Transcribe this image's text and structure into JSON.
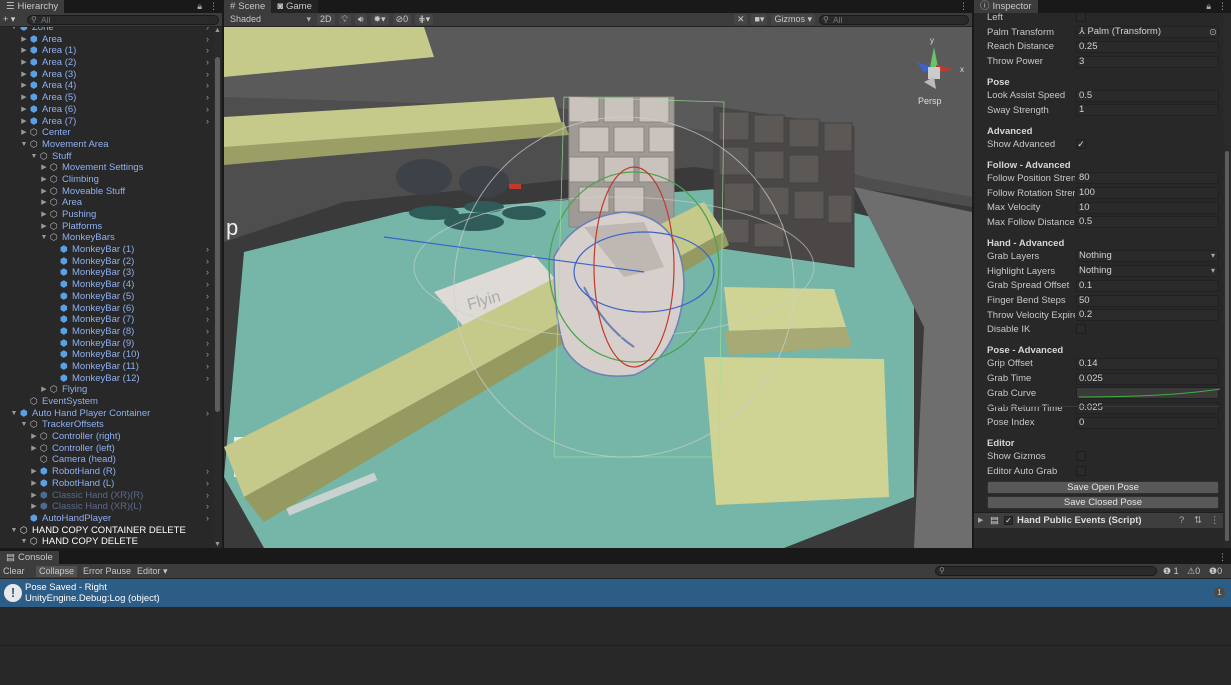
{
  "hierarchy": {
    "tab": "Hierarchy",
    "search_placeholder": "All",
    "add_label": "+ ▾",
    "items": [
      {
        "label": "Zone",
        "depth": 1,
        "arrow": "down",
        "icon": "cube",
        "more": true
      },
      {
        "label": "Area",
        "depth": 2,
        "arrow": "right",
        "icon": "cube",
        "more": true
      },
      {
        "label": "Area (1)",
        "depth": 2,
        "arrow": "right",
        "icon": "cube",
        "more": true
      },
      {
        "label": "Area (2)",
        "depth": 2,
        "arrow": "right",
        "icon": "cube",
        "more": true
      },
      {
        "label": "Area (3)",
        "depth": 2,
        "arrow": "right",
        "icon": "cube",
        "more": true
      },
      {
        "label": "Area (4)",
        "depth": 2,
        "arrow": "right",
        "icon": "cube",
        "more": true
      },
      {
        "label": "Area (5)",
        "depth": 2,
        "arrow": "right",
        "icon": "cube",
        "more": true
      },
      {
        "label": "Area (6)",
        "depth": 2,
        "arrow": "right",
        "icon": "cube",
        "more": true
      },
      {
        "label": "Area (7)",
        "depth": 2,
        "arrow": "right",
        "icon": "cube",
        "more": true
      },
      {
        "label": "Center",
        "depth": 2,
        "arrow": "right",
        "icon": "outline",
        "more": false
      },
      {
        "label": "Movement Area",
        "depth": 2,
        "arrow": "down",
        "icon": "outline",
        "more": false
      },
      {
        "label": "Stuff",
        "depth": 3,
        "arrow": "down",
        "icon": "outline",
        "more": false
      },
      {
        "label": "Movement Settings",
        "depth": 4,
        "arrow": "right",
        "icon": "outline",
        "more": false
      },
      {
        "label": "Climbing",
        "depth": 4,
        "arrow": "right",
        "icon": "outline",
        "more": false
      },
      {
        "label": "Moveable Stuff",
        "depth": 4,
        "arrow": "right",
        "icon": "outline",
        "more": false
      },
      {
        "label": "Area",
        "depth": 4,
        "arrow": "right",
        "icon": "outline",
        "more": false
      },
      {
        "label": "Pushing",
        "depth": 4,
        "arrow": "right",
        "icon": "outline",
        "more": false
      },
      {
        "label": "Platforms",
        "depth": 4,
        "arrow": "right",
        "icon": "outline",
        "more": false
      },
      {
        "label": "MonkeyBars",
        "depth": 4,
        "arrow": "down",
        "icon": "outline",
        "more": false
      },
      {
        "label": "MonkeyBar (1)",
        "depth": 5,
        "arrow": "",
        "icon": "cube",
        "more": true
      },
      {
        "label": "MonkeyBar (2)",
        "depth": 5,
        "arrow": "",
        "icon": "cube",
        "more": true
      },
      {
        "label": "MonkeyBar (3)",
        "depth": 5,
        "arrow": "",
        "icon": "cube",
        "more": true
      },
      {
        "label": "MonkeyBar (4)",
        "depth": 5,
        "arrow": "",
        "icon": "cube",
        "more": true
      },
      {
        "label": "MonkeyBar (5)",
        "depth": 5,
        "arrow": "",
        "icon": "cube",
        "more": true
      },
      {
        "label": "MonkeyBar (6)",
        "depth": 5,
        "arrow": "",
        "icon": "cube",
        "more": true
      },
      {
        "label": "MonkeyBar (7)",
        "depth": 5,
        "arrow": "",
        "icon": "cube",
        "more": true
      },
      {
        "label": "MonkeyBar (8)",
        "depth": 5,
        "arrow": "",
        "icon": "cube",
        "more": true
      },
      {
        "label": "MonkeyBar (9)",
        "depth": 5,
        "arrow": "",
        "icon": "cube",
        "more": true
      },
      {
        "label": "MonkeyBar (10)",
        "depth": 5,
        "arrow": "",
        "icon": "cube",
        "more": true
      },
      {
        "label": "MonkeyBar (11)",
        "depth": 5,
        "arrow": "",
        "icon": "cube",
        "more": true
      },
      {
        "label": "MonkeyBar (12)",
        "depth": 5,
        "arrow": "",
        "icon": "cube",
        "more": true
      },
      {
        "label": "Flying",
        "depth": 4,
        "arrow": "right",
        "icon": "outline",
        "more": false
      },
      {
        "label": "EventSystem",
        "depth": 2,
        "arrow": "",
        "icon": "outline",
        "more": false
      },
      {
        "label": "Auto Hand Player Container",
        "depth": 1,
        "arrow": "down",
        "icon": "cube",
        "more": true
      },
      {
        "label": "TrackerOffsets",
        "depth": 2,
        "arrow": "down",
        "icon": "outline",
        "more": false
      },
      {
        "label": "Controller (right)",
        "depth": 3,
        "arrow": "right",
        "icon": "outline",
        "more": false
      },
      {
        "label": "Controller (left)",
        "depth": 3,
        "arrow": "right",
        "icon": "outline",
        "more": false
      },
      {
        "label": "Camera (head)",
        "depth": 3,
        "arrow": "",
        "icon": "outline",
        "more": false
      },
      {
        "label": "RobotHand (R)",
        "depth": 3,
        "arrow": "right",
        "icon": "cube",
        "more": true
      },
      {
        "label": "RobotHand (L)",
        "depth": 3,
        "arrow": "right",
        "icon": "cube",
        "more": true
      },
      {
        "label": "Classic Hand (XR)(R)",
        "depth": 3,
        "arrow": "right",
        "icon": "cube",
        "more": true,
        "dim": true
      },
      {
        "label": "Classic Hand (XR)(L)",
        "depth": 3,
        "arrow": "right",
        "icon": "cube",
        "more": true,
        "dim": true
      },
      {
        "label": "AutoHandPlayer",
        "depth": 2,
        "arrow": "",
        "icon": "cube",
        "more": true
      },
      {
        "label": "HAND COPY CONTAINER DELETE",
        "depth": 1,
        "arrow": "down",
        "icon": "outline",
        "more": false,
        "white": true
      },
      {
        "label": "HAND COPY DELETE",
        "depth": 2,
        "arrow": "down",
        "icon": "outline",
        "more": false,
        "white": true
      }
    ]
  },
  "scene": {
    "tab_scene": "Scene",
    "tab_game": "Game",
    "shading_mode": "Shaded",
    "mode_2d": "2D",
    "gizmos_label": "Gizmos",
    "search_placeholder": "All",
    "fx_count": "0",
    "persp_label": "Persp",
    "axis_x": "x",
    "axis_y": "y",
    "sign_text_left": "p",
    "sign_text_center": "Flyin"
  },
  "inspector": {
    "tab": "Inspector",
    "rows": [
      {
        "type": "field",
        "label": "Left",
        "kind": "check",
        "value": ""
      },
      {
        "type": "field",
        "label": "Palm Transform",
        "kind": "object",
        "value": "⅄ Palm (Transform)"
      },
      {
        "type": "field",
        "label": "Reach Distance",
        "kind": "text",
        "value": "0.25"
      },
      {
        "type": "field",
        "label": "Throw Power",
        "kind": "text",
        "value": "3"
      },
      {
        "type": "header",
        "label": "Pose"
      },
      {
        "type": "field",
        "label": "Look Assist Speed",
        "kind": "text",
        "value": "0.5"
      },
      {
        "type": "field",
        "label": "Sway Strength",
        "kind": "text",
        "value": "1"
      },
      {
        "type": "header",
        "label": "Advanced"
      },
      {
        "type": "field",
        "label": "Show Advanced",
        "kind": "check",
        "value": "✓"
      },
      {
        "type": "header",
        "label": "Follow - Advanced"
      },
      {
        "type": "field",
        "label": "Follow Position Stren",
        "kind": "text",
        "value": "80"
      },
      {
        "type": "field",
        "label": "Follow Rotation Stren",
        "kind": "text",
        "value": "100"
      },
      {
        "type": "field",
        "label": "Max Velocity",
        "kind": "text",
        "value": "10"
      },
      {
        "type": "field",
        "label": "Max Follow Distance",
        "kind": "text",
        "value": "0.5"
      },
      {
        "type": "header",
        "label": "Hand - Advanced"
      },
      {
        "type": "field",
        "label": "Grab Layers",
        "kind": "drop",
        "value": "Nothing"
      },
      {
        "type": "field",
        "label": "Highlight Layers",
        "kind": "drop",
        "value": "Nothing"
      },
      {
        "type": "field",
        "label": "Grab Spread Offset",
        "kind": "text",
        "value": "0.1"
      },
      {
        "type": "field",
        "label": "Finger Bend Steps",
        "kind": "text",
        "value": "50"
      },
      {
        "type": "field",
        "label": "Throw Velocity Expire",
        "kind": "text",
        "value": "0.2"
      },
      {
        "type": "field",
        "label": "Disable IK",
        "kind": "check",
        "value": ""
      },
      {
        "type": "header",
        "label": "Pose - Advanced"
      },
      {
        "type": "field",
        "label": "Grip Offset",
        "kind": "text",
        "value": "0.14"
      },
      {
        "type": "field",
        "label": "Grab Time",
        "kind": "text",
        "value": "0.025"
      },
      {
        "type": "field",
        "label": "Grab Curve",
        "kind": "curve",
        "value": ""
      },
      {
        "type": "field",
        "label": "Grab Return Time",
        "kind": "text",
        "value": "0.025"
      },
      {
        "type": "field",
        "label": "Pose Index",
        "kind": "text",
        "value": "0"
      },
      {
        "type": "header",
        "label": "Editor"
      },
      {
        "type": "field",
        "label": "Show Gizmos",
        "kind": "check",
        "value": ""
      },
      {
        "type": "field",
        "label": "Editor Auto Grab",
        "kind": "check",
        "value": ""
      }
    ],
    "save_open_pose": "Save Open Pose",
    "save_closed_pose": "Save Closed Pose",
    "component_title": "Hand Public Events (Script)"
  },
  "console": {
    "tab": "Console",
    "clear": "Clear",
    "collapse": "Collapse",
    "error_pause": "Error Pause",
    "editor": "Editor ▾",
    "count_info": "1",
    "count_warn": "0",
    "count_error": "0",
    "log_line1": "Pose Saved - Right",
    "log_line2": "UnityEngine.Debug:Log (object)",
    "log_count": "1"
  },
  "colors": {
    "accent": "#2c5d87",
    "hier_text": "#8fb0f0",
    "panel": "#282828"
  }
}
